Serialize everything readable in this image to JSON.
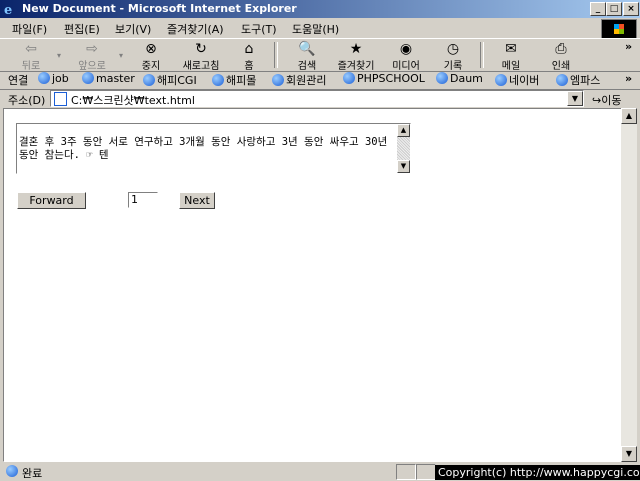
{
  "window": {
    "title": "New Document - Microsoft Internet Explorer",
    "minimize": "_",
    "maximize": "□",
    "close": "×"
  },
  "menu": [
    "파일(F)",
    "편집(E)",
    "보기(V)",
    "즐겨찾기(A)",
    "도구(T)",
    "도움말(H)"
  ],
  "toolbar": {
    "back": "뒤로",
    "forward": "앞으로",
    "stop": "중지",
    "refresh": "새로고침",
    "home": "홈",
    "search": "검색",
    "favorites": "즐겨찾기",
    "media": "미디어",
    "history": "기록",
    "mail": "메일",
    "print": "인쇄",
    "chevron": "»"
  },
  "links": {
    "label": "연결",
    "items": [
      "job",
      "master",
      "해피CGI",
      "해피몰",
      "회원관리",
      "PHPSCHOOL",
      "Daum",
      "네이버",
      "엠파스"
    ],
    "chevron": "»"
  },
  "address": {
    "label": "주소(D)",
    "value": "C:₩스크린샷₩text.html",
    "go": "이동"
  },
  "page": {
    "textarea_text": "결혼 후 3주 동안 서로 연구하고 3개월 동안 사랑하고 3년 동안 싸우고 30년 동안 참는다. ☞ 텐",
    "forward_button": "Forward",
    "page_number": "1",
    "next_button": "Next"
  },
  "status": {
    "text": "완료",
    "copyright": "Copyright(c) http://www.happycgi.com"
  },
  "colors": {
    "titlebar_start": "#0a246a",
    "titlebar_end": "#a6caf0",
    "chrome": "#d4d0c8"
  }
}
